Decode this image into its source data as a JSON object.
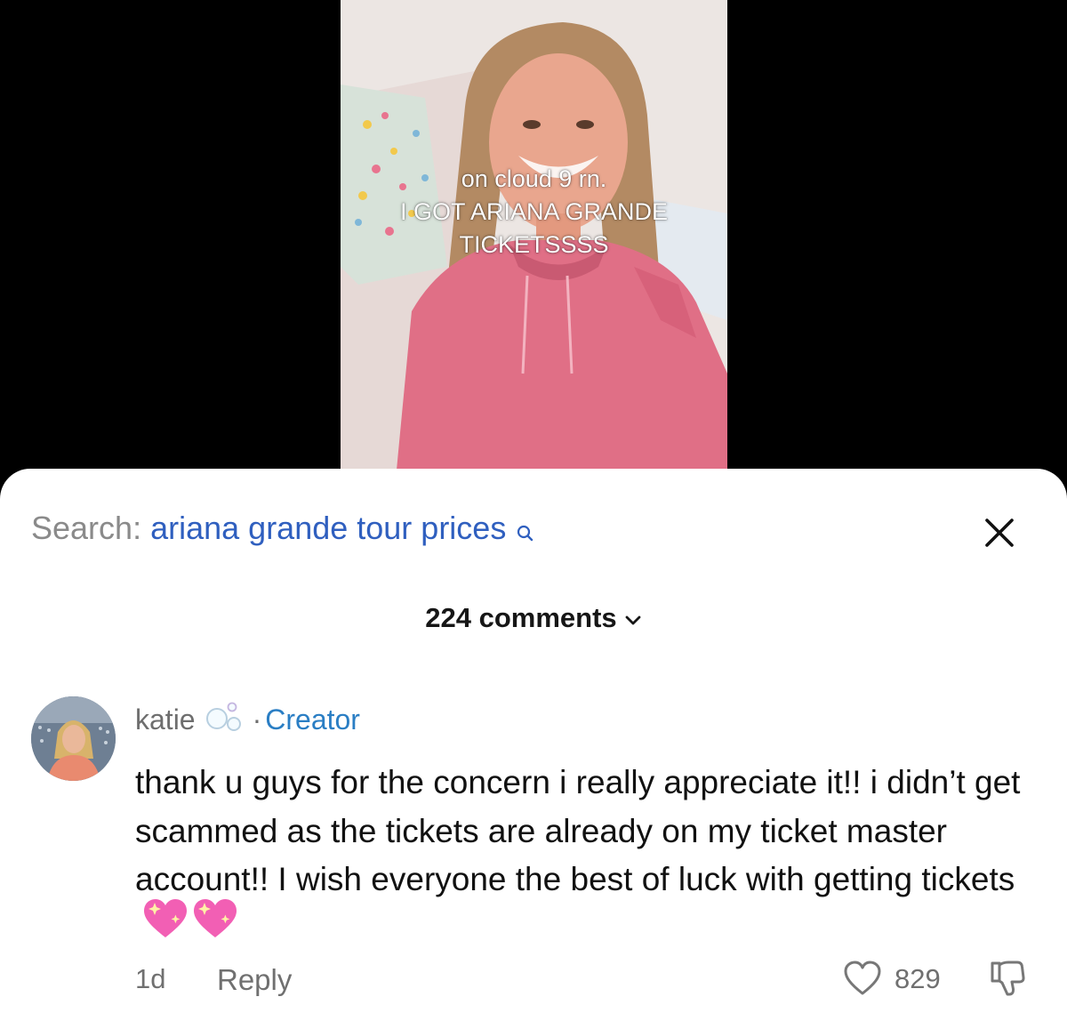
{
  "video": {
    "overlay_lines": [
      "on cloud 9 rn.",
      "I GOT ARIANA GRANDE",
      "TICKETSSSS"
    ]
  },
  "search": {
    "label": "Search:",
    "query": "ariana grande tour prices",
    "icon": "search-icon"
  },
  "close_icon": "close-icon",
  "comments": {
    "count_label": "224 comments",
    "expand_icon": "chevron-down-icon"
  },
  "comment": {
    "author": "katie",
    "author_badge_icon": "bubbles-icon",
    "separator": "·",
    "role": "Creator",
    "text": "thank u guys for the concern i really appreciate it!! i didn’t get scammed as the tickets are already on my ticket master account!! I wish everyone the best of luck with getting tickets",
    "emoji_icon": "sparkling-heart-icon",
    "time": "1d",
    "reply_label": "Reply",
    "like_count": "829",
    "like_icon": "heart-outline-icon",
    "dislike_icon": "thumbs-down-icon"
  },
  "colors": {
    "link_blue": "#2f5fbf",
    "creator_blue": "#2a7ec4",
    "muted": "#707070",
    "hoodie_pink": "#e06f86"
  }
}
